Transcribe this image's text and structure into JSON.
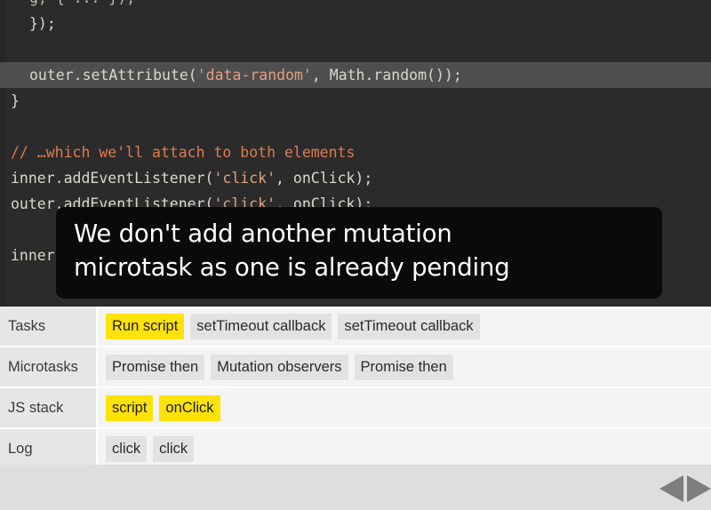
{
  "code_panel": {
    "lines": [
      {
        "id": "line-partial-top",
        "segments": [
          {
            "text": "g, { ... });",
            "cls": "tok-dim"
          }
        ],
        "indent": true,
        "highlight": false,
        "clipped_top": true
      },
      {
        "id": "line-close-callback",
        "segments": [
          {
            "text": "});",
            "cls": "tok-plain"
          }
        ],
        "indent": true,
        "highlight": false
      },
      {
        "id": "line-blank-1",
        "segments": [
          {
            "text": " ",
            "cls": "tok-plain"
          }
        ],
        "indent": false,
        "highlight": false
      },
      {
        "id": "line-setattribute",
        "segments": [
          {
            "text": "outer.setAttribute(",
            "cls": "tok-plain"
          },
          {
            "text": "'data-random'",
            "cls": "tok-str"
          },
          {
            "text": ", Math.random());",
            "cls": "tok-plain"
          }
        ],
        "indent": true,
        "highlight": true
      },
      {
        "id": "line-close-brace",
        "segments": [
          {
            "text": "}",
            "cls": "tok-plain"
          }
        ],
        "indent": false,
        "highlight": false
      },
      {
        "id": "line-blank-2",
        "segments": [
          {
            "text": " ",
            "cls": "tok-plain"
          }
        ],
        "indent": false,
        "highlight": false
      },
      {
        "id": "line-comment-attach",
        "segments": [
          {
            "text": "// …which we'll attach to both elements",
            "cls": "tok-comment"
          }
        ],
        "indent": false,
        "highlight": false
      },
      {
        "id": "line-inner-listener",
        "segments": [
          {
            "text": "inner.addEventListener(",
            "cls": "tok-plain"
          },
          {
            "text": "'click'",
            "cls": "tok-str"
          },
          {
            "text": ", onClick);",
            "cls": "tok-plain"
          }
        ],
        "indent": false,
        "highlight": false
      },
      {
        "id": "line-outer-listener",
        "segments": [
          {
            "text": "outer.addEventListener(",
            "cls": "tok-plain"
          },
          {
            "text": "'click'",
            "cls": "tok-str"
          },
          {
            "text": ", onClick);",
            "cls": "tok-plain"
          }
        ],
        "indent": false,
        "highlight": false
      },
      {
        "id": "line-blank-3",
        "segments": [
          {
            "text": " ",
            "cls": "tok-plain"
          }
        ],
        "indent": false,
        "highlight": false
      },
      {
        "id": "line-inner-click",
        "segments": [
          {
            "text": "inner.click();",
            "cls": "tok-plain"
          }
        ],
        "indent": false,
        "highlight": false
      }
    ]
  },
  "caption": {
    "text": "We don't add another mutation\nmicrotask as one is already pending"
  },
  "timeline": {
    "rows": [
      {
        "label": "Tasks",
        "cells": [
          {
            "text": "Run script",
            "active": true
          },
          {
            "text": "setTimeout callback",
            "active": false
          },
          {
            "text": "setTimeout callback",
            "active": false
          }
        ]
      },
      {
        "label": "Microtasks",
        "cells": [
          {
            "text": "Promise then",
            "active": false
          },
          {
            "text": "Mutation observers",
            "active": false
          },
          {
            "text": "Promise then",
            "active": false
          }
        ]
      },
      {
        "label": "JS stack",
        "cells": [
          {
            "text": "script",
            "active": true
          },
          {
            "text": "onClick",
            "active": true
          }
        ]
      },
      {
        "label": "Log",
        "cells": [
          {
            "text": "click",
            "active": false
          },
          {
            "text": "click",
            "active": false
          }
        ]
      }
    ]
  },
  "footer": {
    "prev_icon": "triangle-left-icon",
    "next_icon": "triangle-right-icon"
  },
  "colors": {
    "code_bg": "#2b2b2b",
    "code_highlight": "#4e4e4e",
    "caption_bg": "#0a0a0a",
    "chip_default": "#e2e2e2",
    "chip_active": "#ffe20a",
    "row_label_bg": "#e6e6e6",
    "footer_bg": "#dedede",
    "arrow": "#7d7d7d"
  }
}
